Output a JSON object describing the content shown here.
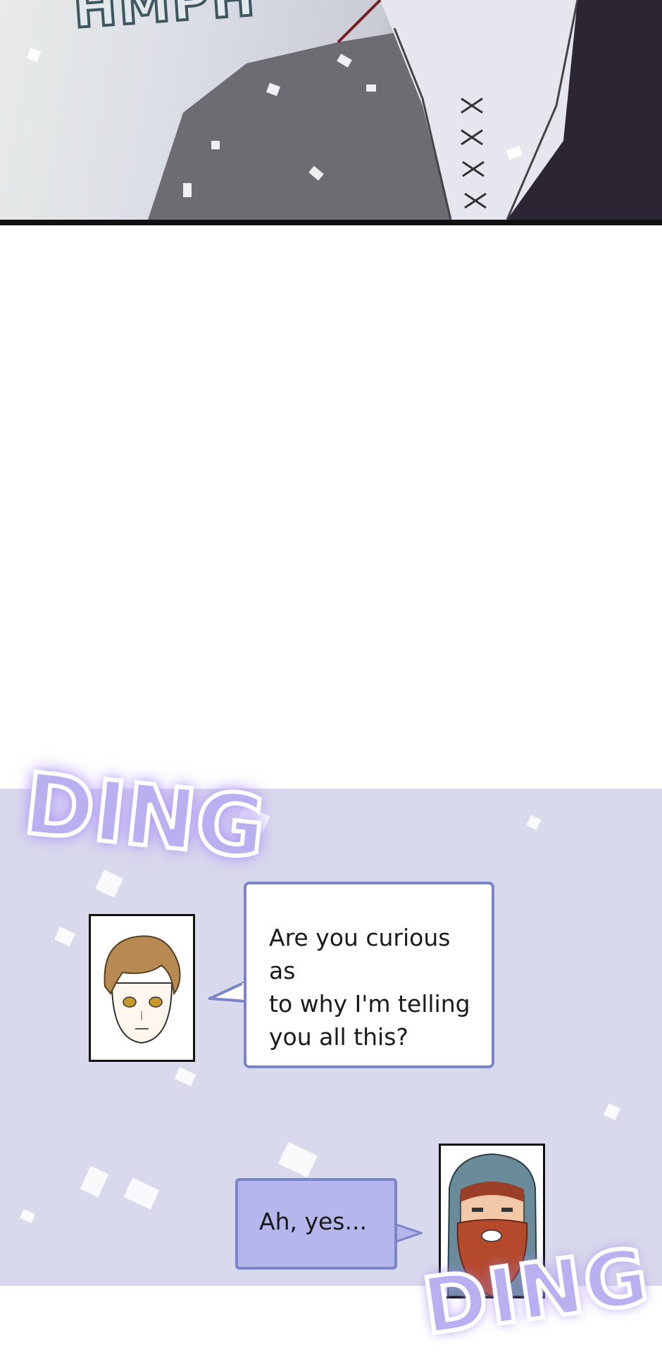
{
  "top_panel": {
    "sfx_text": "HMPH"
  },
  "bottom_panel": {
    "sfx_ding": "DING",
    "speech_1": {
      "line_1": "Are you curious as",
      "line_2": "to why I'm telling",
      "line_3": "you all this?"
    },
    "speech_2": "Ah, yes...",
    "sfx_bottom": "DING"
  },
  "colors": {
    "panel_background": "#d8d9ec",
    "bubble_border": "#7b86c9",
    "reply_bubble": "#b4b6ec",
    "sfx_glow": "#a78cf0"
  }
}
